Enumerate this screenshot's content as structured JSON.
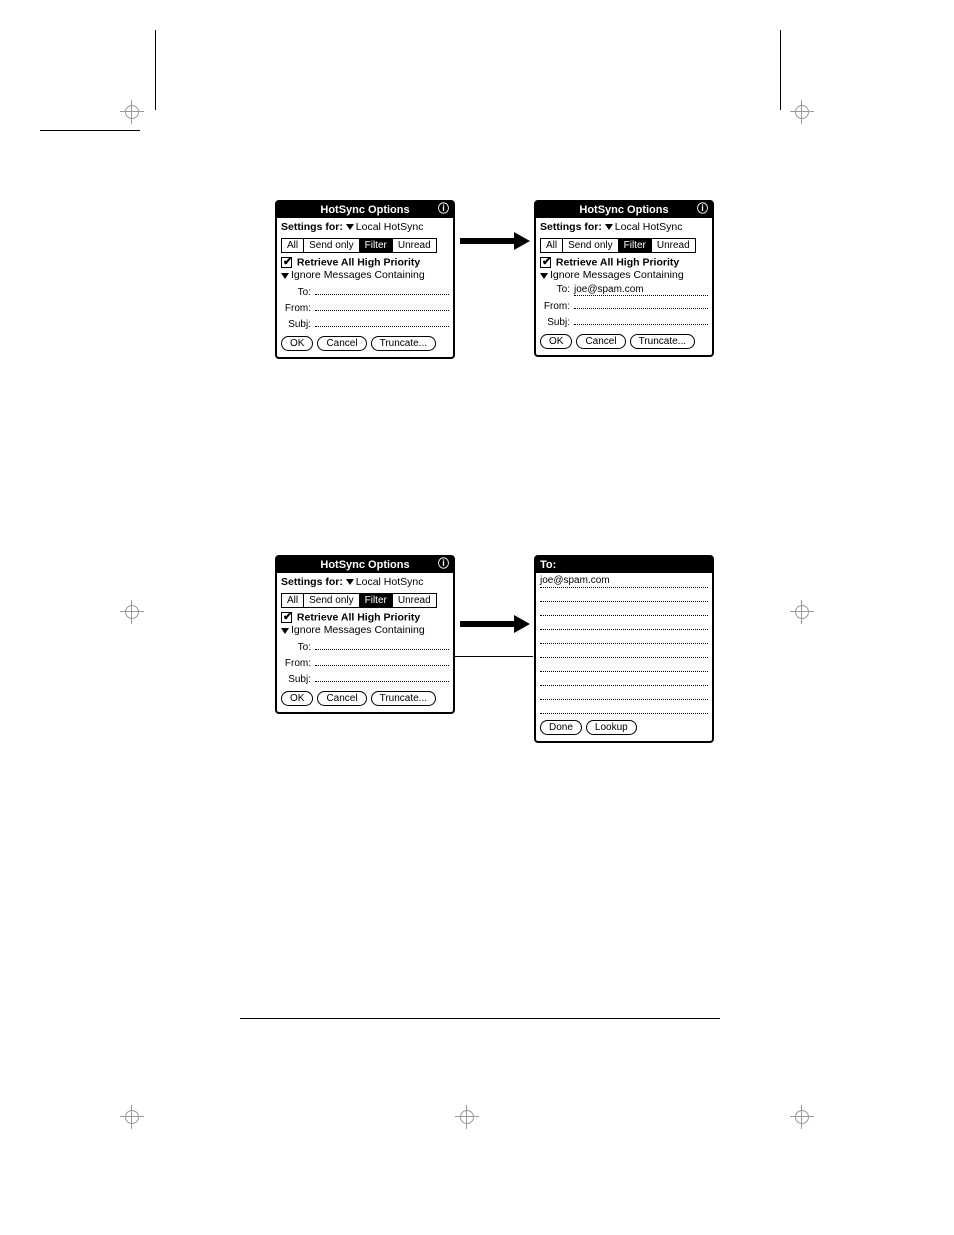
{
  "dialog1": {
    "title": "HotSync Options",
    "info": "ⓘ",
    "settings_label": "Settings for:",
    "settings_value": "Local HotSync",
    "tabs": {
      "all": "All",
      "sendonly": "Send only",
      "filter": "Filter",
      "unread": "Unread"
    },
    "retrieve_label": "Retrieve All High Priority",
    "ignore_label": "Ignore Messages Containing",
    "to_label": "To:",
    "to_value": "",
    "from_label": "From:",
    "from_value": "",
    "subj_label": "Subj:",
    "subj_value": "",
    "ok": "OK",
    "cancel": "Cancel",
    "truncate": "Truncate..."
  },
  "dialog2": {
    "title": "HotSync Options",
    "info": "ⓘ",
    "settings_label": "Settings for:",
    "settings_value": "Local HotSync",
    "tabs": {
      "all": "All",
      "sendonly": "Send only",
      "filter": "Filter",
      "unread": "Unread"
    },
    "retrieve_label": "Retrieve All High Priority",
    "ignore_label": "Ignore Messages Containing",
    "to_label": "To:",
    "to_value": "joe@spam.com",
    "from_label": "From:",
    "from_value": "",
    "subj_label": "Subj:",
    "subj_value": "",
    "ok": "OK",
    "cancel": "Cancel",
    "truncate": "Truncate..."
  },
  "dialog3": {
    "title": "HotSync Options",
    "info": "ⓘ",
    "settings_label": "Settings for:",
    "settings_value": "Local HotSync",
    "tabs": {
      "all": "All",
      "sendonly": "Send only",
      "filter": "Filter",
      "unread": "Unread"
    },
    "retrieve_label": "Retrieve All High Priority",
    "ignore_label": "Ignore Messages Containing",
    "to_label": "To:",
    "to_value": "",
    "from_label": "From:",
    "from_value": "",
    "subj_label": "Subj:",
    "subj_value": "",
    "ok": "OK",
    "cancel": "Cancel",
    "truncate": "Truncate..."
  },
  "todialog": {
    "title": "To:",
    "line1": "joe@spam.com",
    "done": "Done",
    "lookup": "Lookup"
  }
}
